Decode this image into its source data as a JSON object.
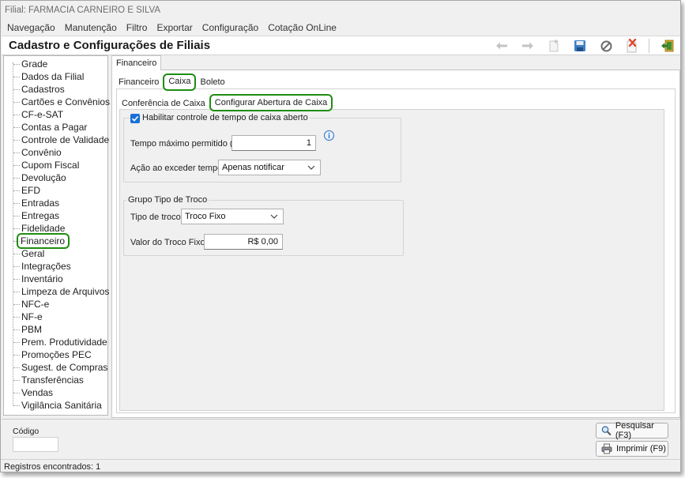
{
  "window": {
    "title": "Filial: FARMACIA CARNEIRO E SILVA"
  },
  "menu": [
    "Navegação",
    "Manutenção",
    "Filtro",
    "Exportar",
    "Configuração",
    "Cotação OnLine"
  ],
  "header": {
    "title": "Cadastro e Configurações de Filiais"
  },
  "toolbar": {
    "icons": [
      "arrow-left-icon",
      "arrow-right-icon",
      "new-record-icon",
      "save-icon",
      "cancel-icon",
      "delete-icon",
      "exit-icon"
    ]
  },
  "sidebar": {
    "items": [
      "Grade",
      "Dados da Filial",
      "Cadastros",
      "Cartões e Convênios",
      "CF-e-SAT",
      "Contas a Pagar",
      "Controle de Validade",
      "Convênio",
      "Cupom Fiscal",
      "Devolução",
      "EFD",
      "Entradas",
      "Entregas",
      "Fidelidade",
      "Financeiro",
      "Geral",
      "Integrações",
      "Inventário",
      "Limpeza de Arquivos",
      "NFC-e",
      "NF-e",
      "PBM",
      "Prem. Produtividade",
      "Promoções PEC",
      "Sugest. de Compras",
      "Transferências",
      "Vendas",
      "Vigilância Sanitária"
    ],
    "selected": "Financeiro"
  },
  "outer_tab": {
    "label": "Financeiro"
  },
  "tabs_level2": [
    {
      "label": "Financeiro",
      "active": false
    },
    {
      "label": "Caixa",
      "active": true
    },
    {
      "label": "Boleto",
      "active": false
    }
  ],
  "tabs_level3": [
    {
      "label": "Conferência de Caixa",
      "active": false
    },
    {
      "label": "Configurar Abertura de Caixa",
      "active": true
    }
  ],
  "group1": {
    "checkbox_label": "Habilitar controle de tempo de caixa aberto",
    "checked": true,
    "tempo_label": "Tempo máximo permitido (h):",
    "tempo_value": "1",
    "acao_label": "Ação ao exceder tempo:",
    "acao_value": "Apenas notificar"
  },
  "group2": {
    "legend": "Grupo Tipo de Troco",
    "tipo_label": "Tipo de troco:",
    "tipo_value": "Troco Fixo",
    "valor_label": "Valor do Troco Fixo:",
    "valor_value": "R$ 0,00"
  },
  "bottom": {
    "codigo_label": "Código",
    "codigo_value": "",
    "pesquisar_label": "Pesquisar (F3)",
    "imprimir_label": "Imprimir (F9)"
  },
  "status": {
    "text": "Registros encontrados: 1"
  },
  "colors": {
    "highlight": "#1f8d12",
    "checkbox": "#1a6fd6",
    "info": "#2a6ebf"
  }
}
